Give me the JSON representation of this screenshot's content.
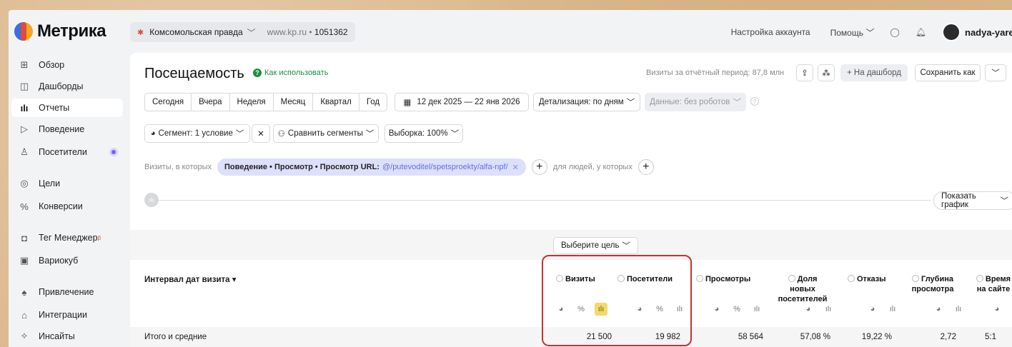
{
  "app": {
    "title": "Метрика"
  },
  "counter": {
    "name": "Комсомольская правда",
    "site": "www.kp.ru",
    "id": "1051362"
  },
  "header": {
    "account_settings": "Настройка аккаунта",
    "help": "Помощь",
    "username": "nadya-yaremen"
  },
  "sidebar": {
    "items": [
      {
        "label": "Обзор",
        "icon": "grid-icon"
      },
      {
        "label": "Дашборды",
        "icon": "dashboard-icon"
      },
      {
        "label": "Отчеты",
        "icon": "bar-chart-icon",
        "active": true
      },
      {
        "label": "Поведение",
        "icon": "play-icon"
      },
      {
        "label": "Посетители",
        "icon": "user-icon"
      },
      {
        "label": "Цели",
        "icon": "target-icon"
      },
      {
        "label": "Конверсии",
        "icon": "percent-icon"
      },
      {
        "label": "Тег Менеджер",
        "sup": "β",
        "icon": "tag-icon"
      },
      {
        "label": "Вариокуб",
        "icon": "cube-icon"
      },
      {
        "label": "Привлечение",
        "icon": "flame-icon"
      },
      {
        "label": "Интеграции",
        "icon": "puzzle-icon"
      },
      {
        "label": "Инсайты",
        "icon": "sparkle-icon"
      }
    ]
  },
  "report": {
    "title": "Посещаемость",
    "howto": "Как использовать",
    "visits_total": "Визиты за отчётный период: 87,8 млн",
    "add_dashboard": "+ На дашборд",
    "save_as": "Сохранить как",
    "periods": [
      "Сегодня",
      "Вчера",
      "Неделя",
      "Месяц",
      "Квартал",
      "Год"
    ],
    "date_range": "12 дек 2025 — 22 янв 2026",
    "detail": "Детализация: по дням",
    "data_filter": "Данные: без роботов",
    "segment": "Сегмент: 1 условие",
    "compare": "Сравнить сегменты",
    "sample": "Выборка: 100%",
    "filter_prefix": "Визиты, в которых",
    "filter_chip": "Поведение • Просмотр • Просмотр URL:",
    "filter_value": "@/putevoditel/spetsproekty/alfa-npf/",
    "people_prefix": "для людей, у которых",
    "show_chart": "Показать график",
    "choose_goal": "Выберите цель",
    "dimension_header": "Интервал дат визита",
    "columns": [
      {
        "l1": "Визиты",
        "l2": "",
        "l3": ""
      },
      {
        "l1": "Посетители",
        "l2": "",
        "l3": ""
      },
      {
        "l1": "Просмотры",
        "l2": "",
        "l3": ""
      },
      {
        "l1": "Доля",
        "l2": "новых",
        "l3": "посетителей"
      },
      {
        "l1": "Отказы",
        "l2": "",
        "l3": ""
      },
      {
        "l1": "Глубина",
        "l2": "просмотра",
        "l3": ""
      },
      {
        "l1": "Время",
        "l2": "на сайте",
        "l3": ""
      }
    ],
    "totals_label": "Итого и средние",
    "totals": [
      "21 500",
      "19 982",
      "58 564",
      "57,08 %",
      "19,22 %",
      "2,72",
      "5:1"
    ]
  }
}
